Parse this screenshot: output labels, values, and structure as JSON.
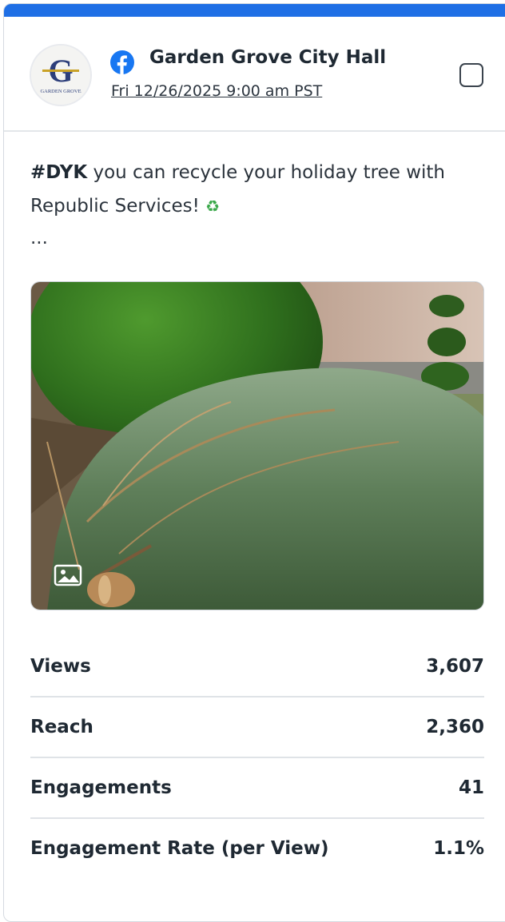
{
  "post": {
    "page_name": "Garden Grove City Hall",
    "date": "Fri 12/26/2025 9:00 am PST",
    "avatar_text": "G",
    "avatar_caption": "GARDEN GROVE",
    "text_hashtag": "#DYK",
    "text_body": " you can recycle your holiday tree with Republic Services! ",
    "text_emoji": "♻",
    "ellipsis": "...",
    "platform_icon": "facebook-icon",
    "media_type_icon": "image-icon"
  },
  "stats": [
    {
      "label": "Views",
      "value": "3,607"
    },
    {
      "label": "Reach",
      "value": "2,360"
    },
    {
      "label": "Engagements",
      "value": "41"
    },
    {
      "label": "Engagement Rate (per View)",
      "value": "1.1%"
    }
  ],
  "colors": {
    "accent": "#1f6fe5",
    "facebook": "#1877f2",
    "border": "#dfe3e7"
  }
}
